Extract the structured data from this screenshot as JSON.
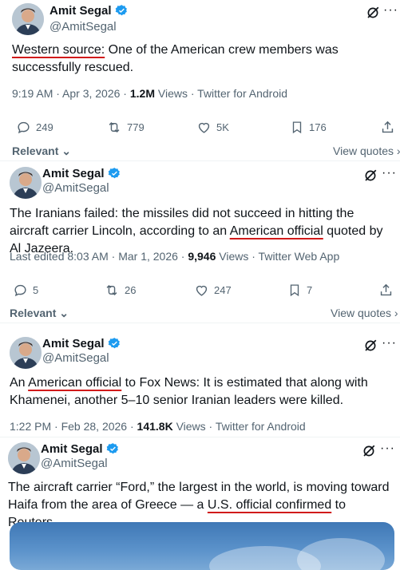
{
  "colors": {
    "verified": "#1d9bf0",
    "underline": "#d11a1a",
    "secondary_text": "#536471",
    "primary_text": "#0f1419"
  },
  "tweets": [
    {
      "author": "Amit Segal",
      "handle": "@AmitSegal",
      "text_underlined": "Western source:",
      "text_rest": " One of the American crew members was successfully rescued.",
      "meta_time": "9:19 AM · Apr 3, 2026 · ",
      "meta_views": "1.2M",
      "meta_tail": " Views · Twitter for Android",
      "replies": "249",
      "reposts": "779",
      "likes": "5K",
      "bookmarks": "176",
      "relevant": "Relevant",
      "view_quotes": "View quotes ›"
    },
    {
      "author": "Amit Segal",
      "handle": "@AmitSegal",
      "text_before": "The Iranians failed: the missiles did not succeed in hitting the aircraft carrier Lincoln, according to an ",
      "text_underlined": "American official",
      "text_after": " quoted by Al Jazeera.",
      "meta_time": "Last edited 8:03 AM · Mar 1, 2026 · ",
      "meta_views": "9,946",
      "meta_tail": " Views · Twitter Web App",
      "replies": "5",
      "reposts": "26",
      "likes": "247",
      "bookmarks": "7",
      "relevant": "Relevant",
      "view_quotes": "View quotes ›"
    },
    {
      "author": "Amit Segal",
      "handle": "@AmitSegal",
      "text_before": "An ",
      "text_underlined": "American official",
      "text_after": " to Fox News: It is estimated that along with Khamenei, another 5–10 senior Iranian leaders were killed.",
      "meta_time": "1:22 PM · Feb 28, 2026 · ",
      "meta_views": "141.8K",
      "meta_tail": " Views · Twitter for Android"
    },
    {
      "author": "Amit Segal",
      "handle": "@AmitSegal",
      "text_before": "The aircraft carrier “Ford,” the largest in the world, is moving toward Haifa from the area of Greece — a ",
      "text_underlined": "U.S. official confirmed",
      "text_after": " to Reuters."
    }
  ]
}
